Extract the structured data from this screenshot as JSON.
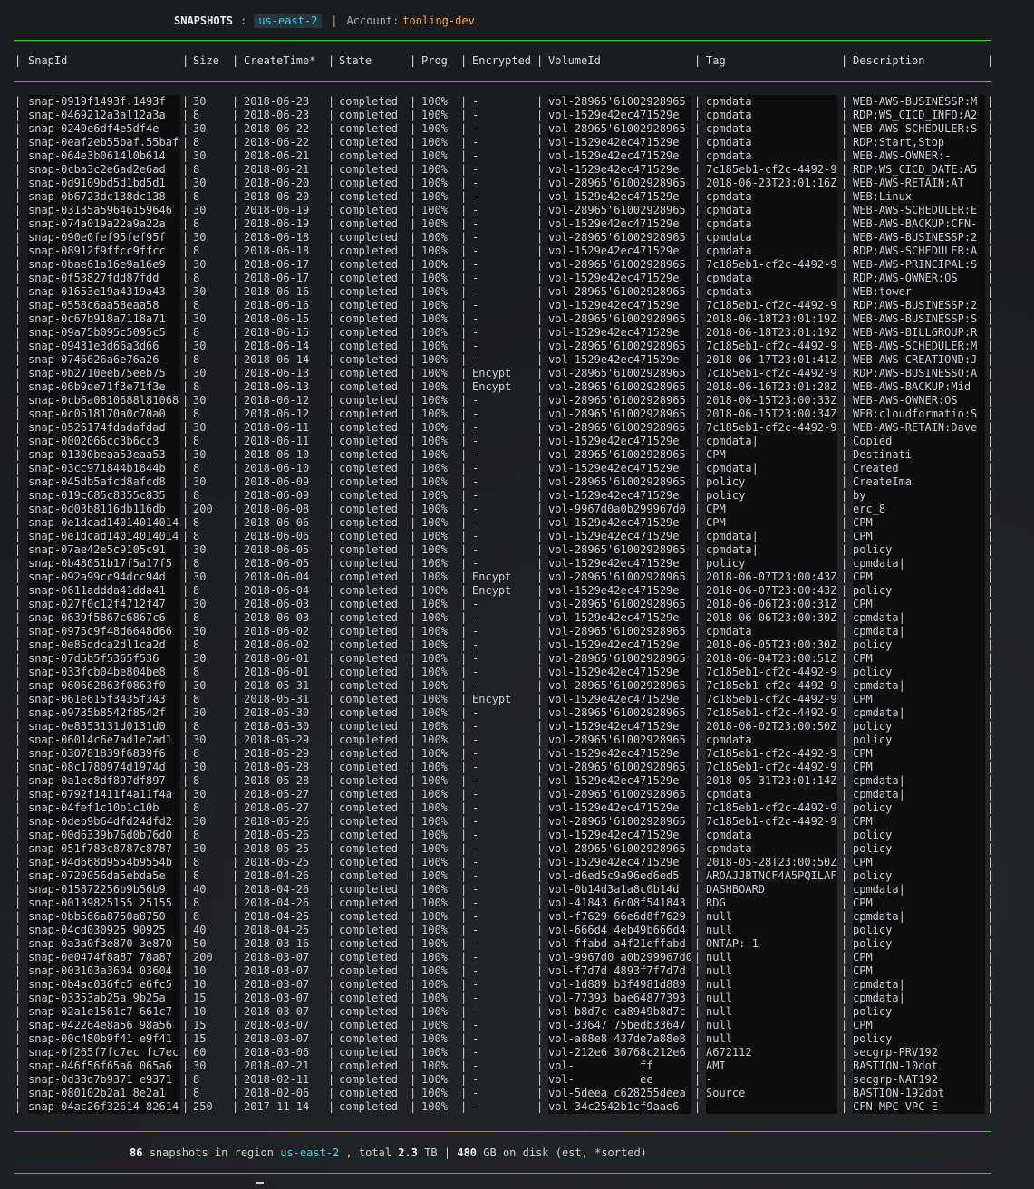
{
  "title": {
    "label": "SNAPSHOTS",
    "colon": ":",
    "region": "us-east-2",
    "sep": "|",
    "account_label": "Account:",
    "account": "tooling-dev"
  },
  "columns": [
    "SnapId",
    "Size",
    "CreateTime*",
    "State",
    "Prog",
    "Encrypted",
    "VolumeId",
    "Tag",
    "Description"
  ],
  "separator": "|",
  "rows": [
    [
      "snap-0919f1493f.1493f",
      "30",
      "2018-06-23",
      "completed",
      "100%",
      "-",
      "vol-28965'61002928965",
      "cpmdata",
      "WEB-AWS-BUSINESSP:M"
    ],
    [
      "snap-0469212a3al12a3a",
      "8",
      "2018-06-23",
      "completed",
      "100%",
      "-",
      "vol-1529e42ec471529e",
      "cpmdata",
      "RDP:WS_CICD_INFO:A2"
    ],
    [
      "snap-0240e6df4e5df4e",
      "30",
      "2018-06-22",
      "completed",
      "100%",
      "-",
      "vol-28965'61002928965",
      "cpmdata",
      "WEB-AWS-SCHEDULER:S"
    ],
    [
      "snap-0eaf2eb55baf.55baf",
      "8",
      "2018-06-22",
      "completed",
      "100%",
      "-",
      "vol-1529e42ec471529e",
      "cpmdata",
      "RDP:Start,Stop"
    ],
    [
      "snap-064e3b0614l0b614",
      "30",
      "2018-06-21",
      "completed",
      "100%",
      "-",
      "vol-1529e42ec471529e",
      "cpmdata",
      "WEB-AWS-OWNER:-"
    ],
    [
      "snap-0cba3c2e6ad2e6ad",
      "8",
      "2018-06-21",
      "completed",
      "100%",
      "-",
      "vol-1529e42ec471529e",
      "7c185eb1-cf2c-4492-9",
      "RDP:WS_CICD_DATE:A5"
    ],
    [
      "snap-0d9109bd5d1bd5d1",
      "30",
      "2018-06-20",
      "completed",
      "100%",
      "-",
      "vol-28965'61002928965",
      "2018-06-23T23:01:16Z",
      "WEB-AWS-RETAIN:AT"
    ],
    [
      "snap-0b6723dc138dc138",
      "8",
      "2018-06-20",
      "completed",
      "100%",
      "-",
      "vol-1529e42ec471529e",
      "cpmdata",
      "WEB:Linux"
    ],
    [
      "snap-03135a59646i59646",
      "30",
      "2018-06-19",
      "completed",
      "100%",
      "-",
      "vol-28965'61002928965",
      "cpmdata",
      "WEB-AWS-SCHEDULER:E"
    ],
    [
      "snap-074a019a22a9a22a",
      "8",
      "2018-06-19",
      "completed",
      "100%",
      "-",
      "vol-1529e42ec471529e",
      "cpmdata",
      "WEB-AWS-BACKUP:CFN-"
    ],
    [
      "snap-090e0fef95fef95f",
      "30",
      "2018-06-18",
      "completed",
      "100%",
      "-",
      "vol-28965'61002928965",
      "cpmdata",
      "WEB-AWS-BUSINESSP:2"
    ],
    [
      "snap-08912f9ffcc9ffcc",
      "8",
      "2018-06-18",
      "completed",
      "100%",
      "-",
      "vol-1529e42ec471529e",
      "cpmdata",
      "RDP:AWS-SCHEDULER:A"
    ],
    [
      "snap-0bae61a16e9a16e9",
      "30",
      "2018-06-17",
      "completed",
      "100%",
      "-",
      "vol-28965'61002928965",
      "7c185eb1-cf2c-4492-9",
      "WEB-AWS-PRINCIPAL:S"
    ],
    [
      "snap-0f53827fdd87fdd",
      "8",
      "2018-06-17",
      "completed",
      "100%",
      "-",
      "vol-1529e42ec471529e",
      "cpmdata",
      "RDP:AWS-OWNER:OS"
    ],
    [
      "snap-01653e19a4319a43",
      "30",
      "2018-06-16",
      "completed",
      "100%",
      "-",
      "vol-28965'61002928965",
      "cpmdata",
      "WEB:tower"
    ],
    [
      "snap-0558c6aa58eaa58",
      "8",
      "2018-06-16",
      "completed",
      "100%",
      "-",
      "vol-1529e42ec471529e",
      "7c185eb1-cf2c-4492-9",
      "RDP:AWS-BUSINESSP:2"
    ],
    [
      "snap-0c67b918a7118a71",
      "30",
      "2018-06-15",
      "completed",
      "100%",
      "-",
      "vol-28965'61002928965",
      "2018-06-18T23:01:19Z",
      "WEB-AWS-BUSINESSP:S"
    ],
    [
      "snap-09a75b095c5095c5",
      "8",
      "2018-06-15",
      "completed",
      "100%",
      "-",
      "vol-1529e42ec471529e",
      "2018-06-18T23:01:19Z",
      "WEB-AWS-BILLGROUP:R"
    ],
    [
      "snap-09431e3d66a3d66",
      "30",
      "2018-06-14",
      "completed",
      "100%",
      "-",
      "vol-28965'61002928965",
      "7c185eb1-cf2c-4492-9",
      "WEB-AWS-SCHEDULER:M"
    ],
    [
      "snap-0746626a6e76a26",
      "8",
      "2018-06-14",
      "completed",
      "100%",
      "-",
      "vol-1529e42ec471529e",
      "2018-06-17T23:01:41Z",
      "WEB-AWS-CREATIOND:J"
    ],
    [
      "snap-0b2710eeb75eeb75",
      "30",
      "2018-06-13",
      "completed",
      "100%",
      "Encypt",
      "vol-28965'61002928965",
      "7c185eb1-cf2c-4492-9",
      "RDP:AWS-BUSINESSO:A"
    ],
    [
      "snap-06b9de71f3e71f3e",
      "8",
      "2018-06-13",
      "completed",
      "100%",
      "Encypt",
      "vol-28965'61002928965",
      "2018-06-16T23:01:28Z",
      "WEB-AWS-BACKUP:Mid"
    ],
    [
      "snap-0cb6a0810688l81068",
      "30",
      "2018-06-12",
      "completed",
      "100%",
      "-",
      "vol-28965'61002928965",
      "2018-06-15T23:00:33Z",
      "WEB-AWS-OWNER:OS"
    ],
    [
      "snap-0c0518170a0c70a0",
      "8",
      "2018-06-12",
      "completed",
      "100%",
      "-",
      "vol-28965'61002928965",
      "2018-06-15T23:00:34Z",
      "WEB:cloudformatio:S"
    ],
    [
      "snap-0526174fdadafdad",
      "30",
      "2018-06-11",
      "completed",
      "100%",
      "-",
      "vol-28965'61002928965",
      "7c185eb1-cf2c-4492-9",
      "WEB-AWS-RETAIN:Dave"
    ],
    [
      "snap-0002066cc3b6cc3",
      "8",
      "2018-06-11",
      "completed",
      "100%",
      "-",
      "vol-1529e42ec471529e",
      "cpmdata|",
      "Copied"
    ],
    [
      "snap-01300beaa53eaa53",
      "30",
      "2018-06-10",
      "completed",
      "100%",
      "-",
      "vol-28965'61002928965",
      "CPM",
      "Destinati"
    ],
    [
      "snap-03cc971844b1844b",
      "8",
      "2018-06-10",
      "completed",
      "100%",
      "-",
      "vol-1529e42ec471529e",
      "cpmdata|",
      "Created"
    ],
    [
      "snap-045db5afcd8afcd8",
      "30",
      "2018-06-09",
      "completed",
      "100%",
      "-",
      "vol-28965'61002928965",
      "policy",
      "CreateIma"
    ],
    [
      "snap-019c685c8355c835",
      "8",
      "2018-06-09",
      "completed",
      "100%",
      "-",
      "vol-1529e42ec471529e",
      "policy",
      "by"
    ],
    [
      "snap-0d03b8116db116db",
      "200",
      "2018-06-08",
      "completed",
      "100%",
      "-",
      "vol-9967d0a0b299967d0",
      "CPM",
      "erc_8"
    ],
    [
      "snap-0e1dcad14014014014",
      "8",
      "2018-06-06",
      "completed",
      "100%",
      "-",
      "vol-1529e42ec471529e",
      "CPM",
      "CPM"
    ],
    [
      "snap-0e1dcad14014014014",
      "8",
      "2018-06-06",
      "completed",
      "100%",
      "-",
      "vol-1529e42ec471529e",
      "cpmdata|",
      "CPM"
    ],
    [
      "snap-07ae42e5c9105c91",
      "30",
      "2018-06-05",
      "completed",
      "100%",
      "-",
      "vol-28965'61002928965",
      "cpmdata|",
      "policy"
    ],
    [
      "snap-0b48051b17f5a17f5",
      "8",
      "2018-06-05",
      "completed",
      "100%",
      "-",
      "vol-1529e42ec471529e",
      "policy",
      "cpmdata|"
    ],
    [
      "snap-092a99cc94dcc94d",
      "30",
      "2018-06-04",
      "completed",
      "100%",
      "Encypt",
      "vol-28965'61002928965",
      "2018-06-07T23:00:43Z",
      "CPM"
    ],
    [
      "snap-0611addda41dda41",
      "8",
      "2018-06-04",
      "completed",
      "100%",
      "Encypt",
      "vol-1529e42ec471529e",
      "2018-06-07T23:00:43Z",
      "policy"
    ],
    [
      "snap-027f0c12f4712f47",
      "30",
      "2018-06-03",
      "completed",
      "100%",
      "-",
      "vol-28965'61002928965",
      "2018-06-06T23:00:31Z",
      "CPM"
    ],
    [
      "snap-0639f5867c6867c6",
      "8",
      "2018-06-03",
      "completed",
      "100%",
      "-",
      "vol-1529e42ec471529e",
      "2018-06-06T23:00:30Z",
      "cpmdata|"
    ],
    [
      "snap-0975c9f48d6648d66",
      "30",
      "2018-06-02",
      "completed",
      "100%",
      "-",
      "vol-28965'61002928965",
      "cpmdata",
      "cpmdata|"
    ],
    [
      "snap-0e85ddca2dl1ca2d",
      "8",
      "2018-06-02",
      "completed",
      "100%",
      "-",
      "vol-1529e42ec471529e",
      "2018-06-05T23:00:30Z",
      "policy"
    ],
    [
      "snap-07d5b5f5365f536",
      "30",
      "2018-06-01",
      "completed",
      "100%",
      "-",
      "vol-28965'61002928965",
      "2018-06-04T23:00:51Z",
      "CPM"
    ],
    [
      "snap-033fcb04be804be8",
      "8",
      "2018-06-01",
      "completed",
      "100%",
      "-",
      "vol-1529e42ec471529e",
      "7c185eb1-cf2c-4492-9",
      "policy"
    ],
    [
      "snap-060662863f0863f0",
      "30",
      "2018-05-31",
      "completed",
      "100%",
      "-",
      "vol-28965'61002928965",
      "7c185eb1-cf2c-4492-9",
      "cpmdata|"
    ],
    [
      "snap-061e615f3435f343",
      "8",
      "2018-05-31",
      "completed",
      "100%",
      "Encypt",
      "vol-1529e42ec471529e",
      "7c185eb1-cf2c-4492-9",
      "CPM"
    ],
    [
      "snap-09735b8542f8542f",
      "30",
      "2018-05-30",
      "completed",
      "100%",
      "-",
      "vol-28965'61002928965",
      "7c185eb1-cf2c-4492-9",
      "cpmdata|"
    ],
    [
      "snap-0e8353131d0131d0",
      "8",
      "2018-05-30",
      "completed",
      "100%",
      "-",
      "vol-1529e42ec471529e",
      "2018-06-02T23:00:50Z",
      "policy"
    ],
    [
      "snap-06014c6e7ad1e7ad1",
      "30",
      "2018-05-29",
      "completed",
      "100%",
      "-",
      "vol-28965'61002928965",
      "cpmdata",
      "policy"
    ],
    [
      "snap-030781839f6839f6",
      "8",
      "2018-05-29",
      "completed",
      "100%",
      "-",
      "vol-1529e42ec471529e",
      "7c185eb1-cf2c-4492-9",
      "CPM"
    ],
    [
      "snap-08c1780974d1974d",
      "30",
      "2018-05-28",
      "completed",
      "100%",
      "-",
      "vol-28965'61002928965",
      "7c185eb1-cf2c-4492-9",
      "CPM"
    ],
    [
      "snap-0a1ec8df897df897",
      "8",
      "2018-05-28",
      "completed",
      "100%",
      "-",
      "vol-1529e42ec471529e",
      "2018-05-31T23:01:14Z",
      "cpmdata|"
    ],
    [
      "snap-0792f1411f4a11f4a",
      "30",
      "2018-05-27",
      "completed",
      "100%",
      "-",
      "vol-28965'61002928965",
      "cpmdata",
      "cpmdata|"
    ],
    [
      "snap-04fef1c10b1c10b",
      "8",
      "2018-05-27",
      "completed",
      "100%",
      "-",
      "vol-1529e42ec471529e",
      "7c185eb1-cf2c-4492-9",
      "policy"
    ],
    [
      "snap-0deb9b64dfd24dfd2",
      "30",
      "2018-05-26",
      "completed",
      "100%",
      "-",
      "vol-28965'61002928965",
      "7c185eb1-cf2c-4492-9",
      "CPM"
    ],
    [
      "snap-00d6339b76d0b76d0",
      "8",
      "2018-05-26",
      "completed",
      "100%",
      "-",
      "vol-1529e42ec471529e",
      "cpmdata",
      "policy"
    ],
    [
      "snap-051f783c8787c8787",
      "30",
      "2018-05-25",
      "completed",
      "100%",
      "-",
      "vol-28965'61002928965",
      "cpmdata",
      "policy"
    ],
    [
      "snap-04d668d9554b9554b",
      "8",
      "2018-05-25",
      "completed",
      "100%",
      "-",
      "vol-1529e42ec471529e",
      "2018-05-28T23:00:50Z",
      "CPM"
    ],
    [
      "snap-0720056da5ebda5e",
      "8",
      "2018-04-26",
      "completed",
      "100%",
      "-",
      "vol-d6ed5c9a96ed6ed5",
      "AROAJJBTNCF4A5PQILAF",
      "policy"
    ],
    [
      "snap-015872256b9b56b9",
      "40",
      "2018-04-26",
      "completed",
      "100%",
      "-",
      "vol-0b14d3a1a8c0b14d",
      "DASHBOARD",
      "cpmdata|"
    ],
    [
      "snap-00139825155 25155",
      "8",
      "2018-04-26",
      "completed",
      "100%",
      "-",
      "vol-41843 6c08f541843",
      "RDG",
      "CPM"
    ],
    [
      "snap-0bb566a8750a8750",
      "8",
      "2018-04-25",
      "completed",
      "100%",
      "-",
      "vol-f7629 66e6d8f7629",
      "null",
      "cpmdata|"
    ],
    [
      "snap-04cd030925 90925",
      "40",
      "2018-04-25",
      "completed",
      "100%",
      "-",
      "vol-666d4 4eb49b666d4",
      "null",
      "policy"
    ],
    [
      "snap-0a3a0f3e870 3e870",
      "50",
      "2018-03-16",
      "completed",
      "100%",
      "-",
      "vol-ffabd a4f21effabd",
      "ONTAP:-1",
      "policy"
    ],
    [
      "snap-0e0474f8a87 78a87",
      "200",
      "2018-03-07",
      "completed",
      "100%",
      "-",
      "vol-9967d0 a0b299967d0",
      "null",
      "CPM"
    ],
    [
      "snap-003103a3604 03604",
      "10",
      "2018-03-07",
      "completed",
      "100%",
      "-",
      "vol-f7d7d 4893f7f7d7d",
      "null",
      "CPM"
    ],
    [
      "snap-0b4ac036fc5 e6fc5",
      "10",
      "2018-03-07",
      "completed",
      "100%",
      "-",
      "vol-1d889 b3f4981d889",
      "null",
      "cpmdata|"
    ],
    [
      "snap-03353ab25a 9b25a",
      "15",
      "2018-03-07",
      "completed",
      "100%",
      "-",
      "vol-77393 bae64877393",
      "null",
      "cpmdata|"
    ],
    [
      "snap-02a1e1561c7 661c7",
      "10",
      "2018-03-07",
      "completed",
      "100%",
      "-",
      "vol-b8d7c ca8949b8d7c",
      "null",
      "policy"
    ],
    [
      "snap-042264e8a56 98a56",
      "15",
      "2018-03-07",
      "completed",
      "100%",
      "-",
      "vol-33647 75bedb33647",
      "null",
      "CPM"
    ],
    [
      "snap-00c480b9f41 e9f41",
      "15",
      "2018-03-07",
      "completed",
      "100%",
      "-",
      "vol-a88e8 437de7a88e8",
      "null",
      "policy"
    ],
    [
      "snap-0f265f7fc7ec fc7ec",
      "60",
      "2018-03-06",
      "completed",
      "100%",
      "-",
      "vol-212e6 30768c212e6",
      "A672112",
      "secgrp-PRV192"
    ],
    [
      "snap-046f56f65a6 065a6",
      "30",
      "2018-02-21",
      "completed",
      "100%",
      "-",
      "vol-          ff",
      "AMI",
      "BASTION-10dot"
    ],
    [
      "snap-0d33d7b9371 e9371",
      "8",
      "2018-02-11",
      "completed",
      "100%",
      "-",
      "vol-          ee",
      "-",
      "secgrp-NAT192"
    ],
    [
      "snap-080102b2a1 8e2a1",
      "8",
      "2018-02-06",
      "completed",
      "100%",
      "-",
      "vol-5deea c628255deea",
      "Source",
      "BASTION-192dot"
    ],
    [
      "snap-04ac26f32614 82614",
      "250",
      "2017-11-14",
      "completed",
      "100%",
      "-",
      "vol-34c2542b1cf9aae6",
      "-",
      "CFN-MPC-VPC-E"
    ]
  ],
  "footer": {
    "count": "86",
    "text1": "snapshots in region",
    "region": "us-east-2",
    "text2": ", total",
    "total": "2.3",
    "unit1": "TB",
    "sep": "|",
    "disk": "480",
    "text3": "GB on disk (est,",
    "sorted": "*sorted)"
  }
}
